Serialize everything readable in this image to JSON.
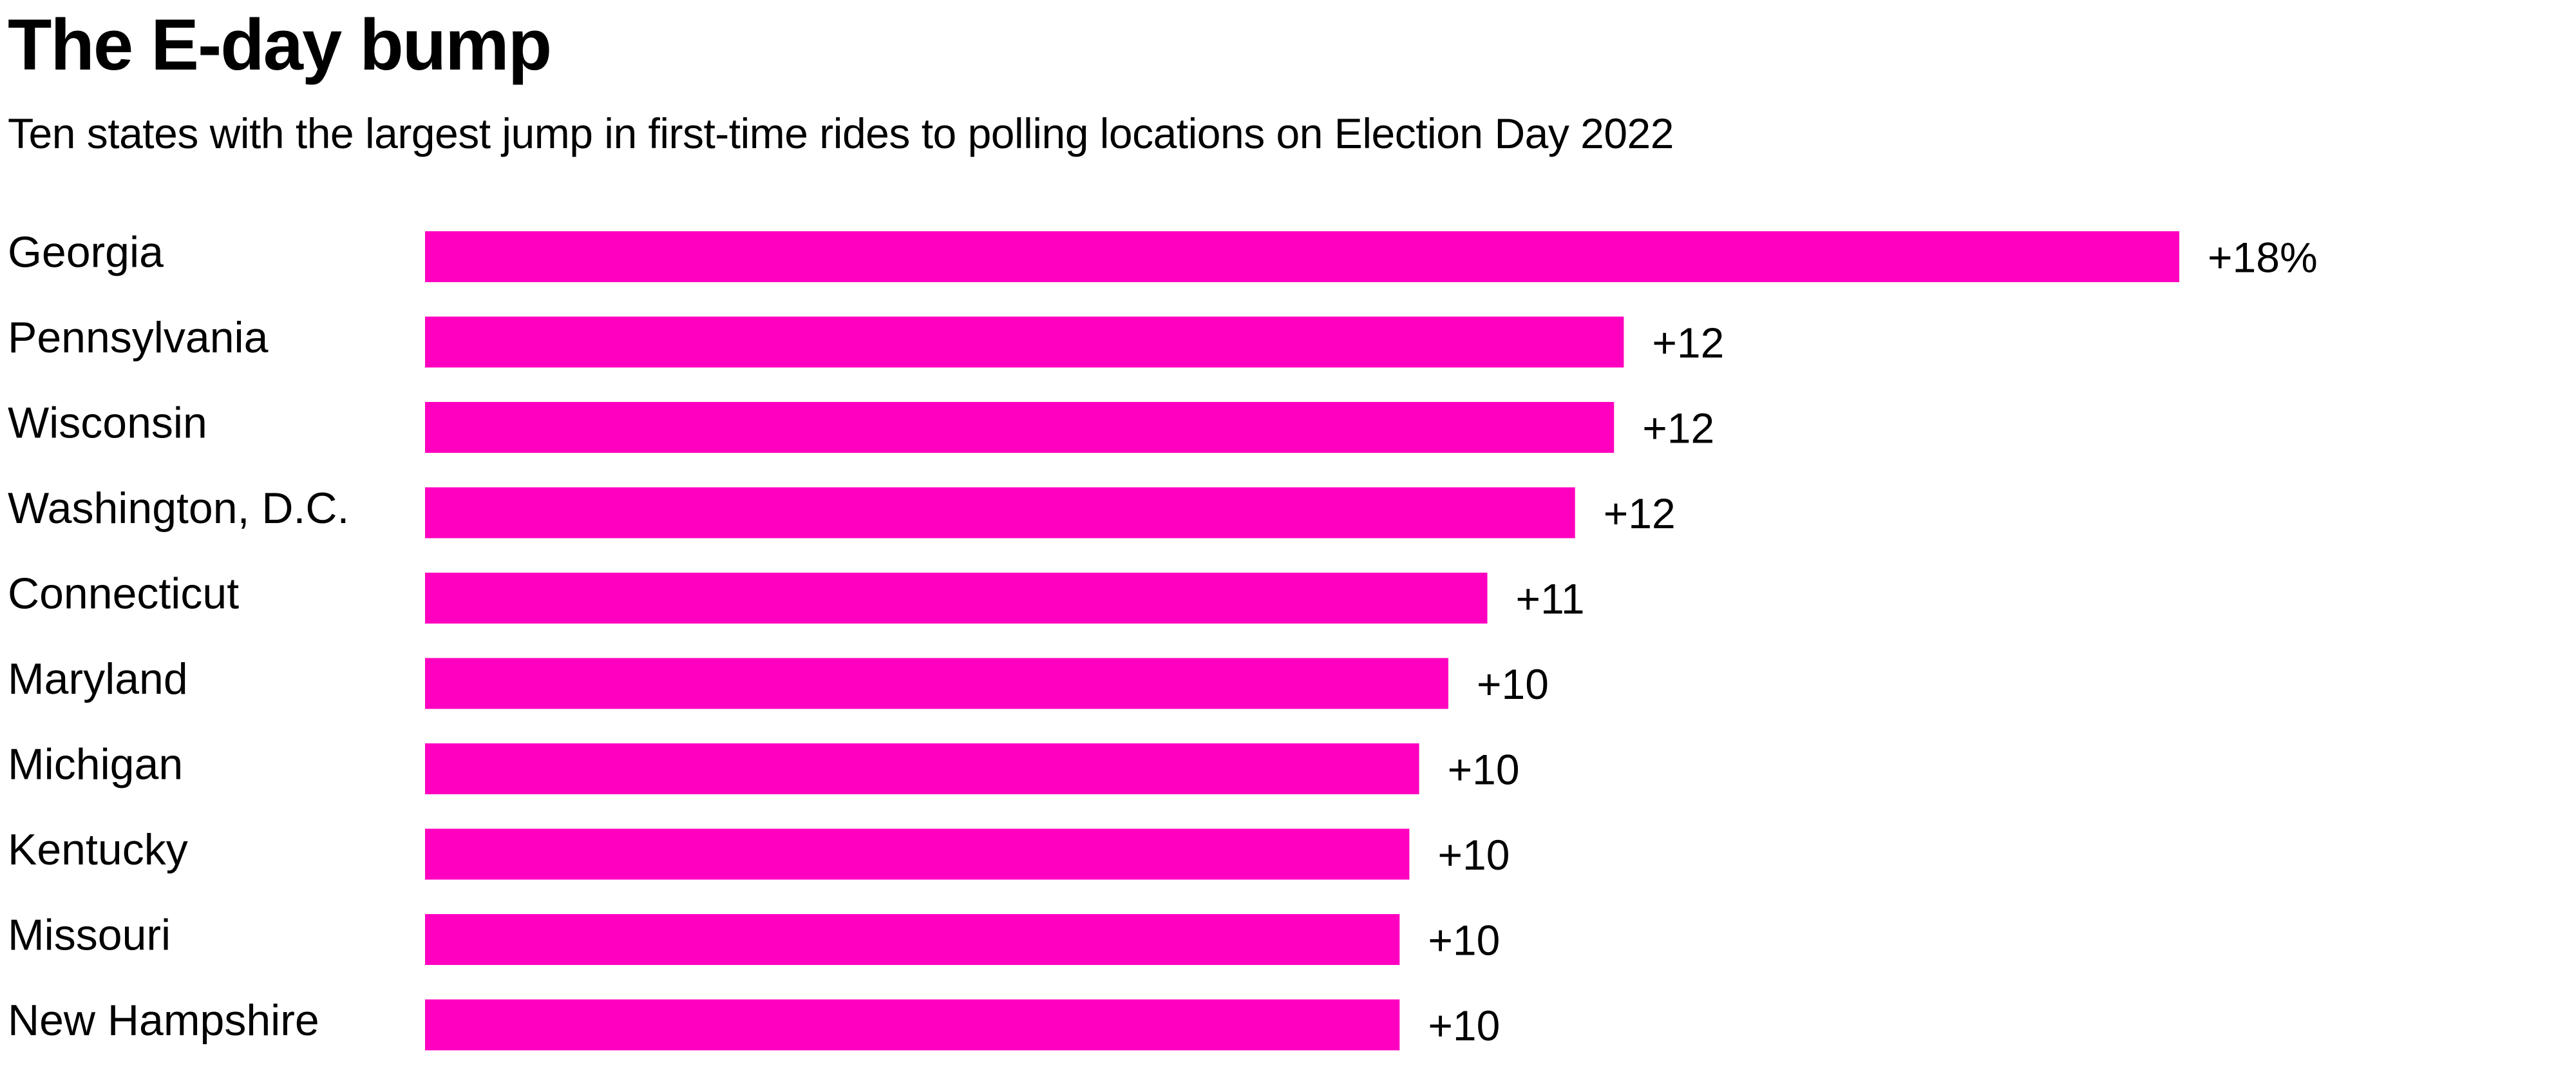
{
  "chart_data": {
    "type": "bar",
    "orientation": "horizontal",
    "title": "The E-day bump",
    "subtitle": "Ten states with the largest jump in first-time rides to polling locations on Election Day 2022",
    "xlabel": "",
    "ylabel": "",
    "unit": "%",
    "xlim": [
      0,
      18
    ],
    "grid": false,
    "legend": "none",
    "bar_color": "#ff00c0",
    "categories": [
      "Georgia",
      "Pennsylvania",
      "Wisconsin",
      "Washington, D.C.",
      "Connecticut",
      "Maryland",
      "Michigan",
      "Kentucky",
      "Missouri",
      "New Hampshire"
    ],
    "values": [
      18,
      12.3,
      12.2,
      11.8,
      10.9,
      10.5,
      10.2,
      10.1,
      10.0,
      10.0
    ],
    "data_labels": [
      "+18%",
      "+12",
      "+12",
      "+12",
      "+11",
      "+10",
      "+10",
      "+10",
      "+10",
      "+10"
    ]
  }
}
